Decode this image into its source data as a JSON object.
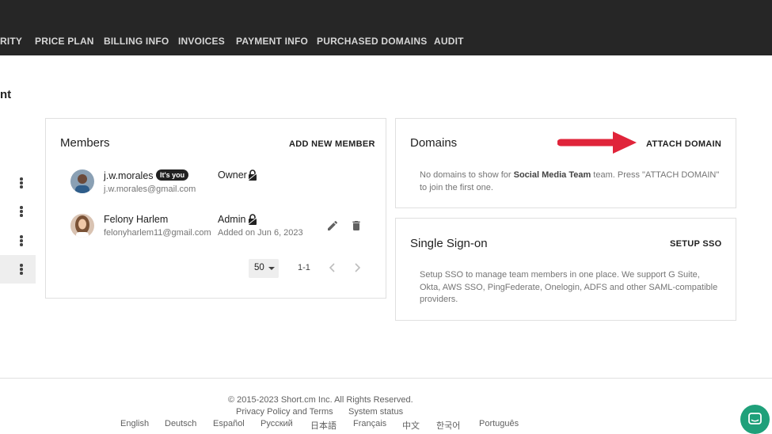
{
  "nav": {
    "items": [
      {
        "label": "RITY"
      },
      {
        "label": "PRICE PLAN"
      },
      {
        "label": "BILLING INFO"
      },
      {
        "label": "INVOICES"
      },
      {
        "label": "PAYMENT INFO"
      },
      {
        "label": "PURCHASED DOMAINS"
      },
      {
        "label": "AUDIT"
      }
    ]
  },
  "page": {
    "title": "nt"
  },
  "members": {
    "title": "Members",
    "add_label": "ADD NEW MEMBER",
    "list": [
      {
        "name": "j.w.morales",
        "badge": "It's you",
        "email": "j.w.morales@gmail.com",
        "role": "Owner",
        "added": ""
      },
      {
        "name": "Felony Harlem",
        "badge": "",
        "email": "felonyharlem11@gmail.com",
        "role": "Admin",
        "added": "Added on Jun 6, 2023"
      }
    ],
    "pagination": {
      "per_page": "50",
      "range": "1-1"
    }
  },
  "domains": {
    "title": "Domains",
    "action": "ATTACH DOMAIN",
    "desc_before": "No domains to show for ",
    "desc_team": "Social Media Team",
    "desc_after": " team. Press \"ATTACH DOMAIN\" to join the first one.",
    "arrow_color": "#e0243a"
  },
  "sso": {
    "title": "Single Sign-on",
    "action": "SETUP SSO",
    "desc": "Setup SSO to manage team members in one place. We support G Suite, Okta, AWS SSO, PingFederate, Onelogin, ADFS and other SAML-compatible providers."
  },
  "footer": {
    "copyright": "© 2015-2023  Short.cm Inc. All Rights Reserved.",
    "privacy": "Privacy Policy and Terms",
    "status": "System status",
    "languages": [
      "English",
      "Deutsch",
      "Español",
      "Русский",
      "日本語",
      "Français",
      "中文",
      "한국어",
      "Português"
    ]
  },
  "colors": {
    "topbar": "#262626",
    "chat": "#1fa07a"
  }
}
